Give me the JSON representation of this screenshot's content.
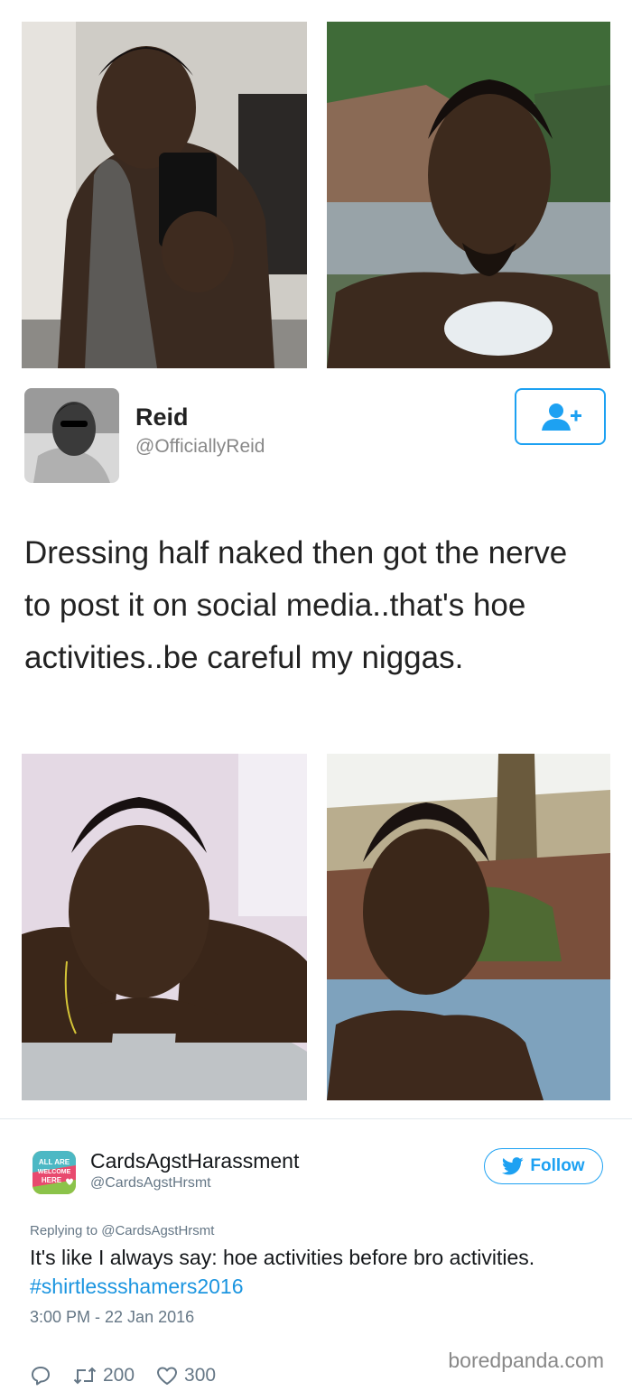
{
  "tweet1": {
    "name": "Reid",
    "handle": "@OfficiallyReid",
    "text": "Dressing half naked then got the nerve to post it on social media..that's hoe activities..be careful my niggas."
  },
  "tweet2": {
    "name": "CardsAgstHarassment",
    "handle": "@CardsAgstHrsmt",
    "logo_text": [
      "ALL ARE",
      "WELCOME",
      "HERE"
    ],
    "follow_label": "Follow",
    "replying_to": "Replying to @CardsAgstHrsmt",
    "text": "It's like I always say: hoe activities before bro activities. ",
    "hashtag": "#shirtlessshamers2016",
    "timestamp": "3:00 PM - 22 Jan 2016",
    "retweets": "200",
    "likes": "300"
  },
  "watermark": "boredpanda.com",
  "icons": {
    "follow_person": "add-person-icon",
    "twitter_bird": "twitter-bird-icon",
    "reply": "reply-icon",
    "retweet": "retweet-icon",
    "like": "heart-icon"
  },
  "colors": {
    "accent": "#1da1f2",
    "hashtag": "#1b95e0",
    "muted": "#657786"
  }
}
